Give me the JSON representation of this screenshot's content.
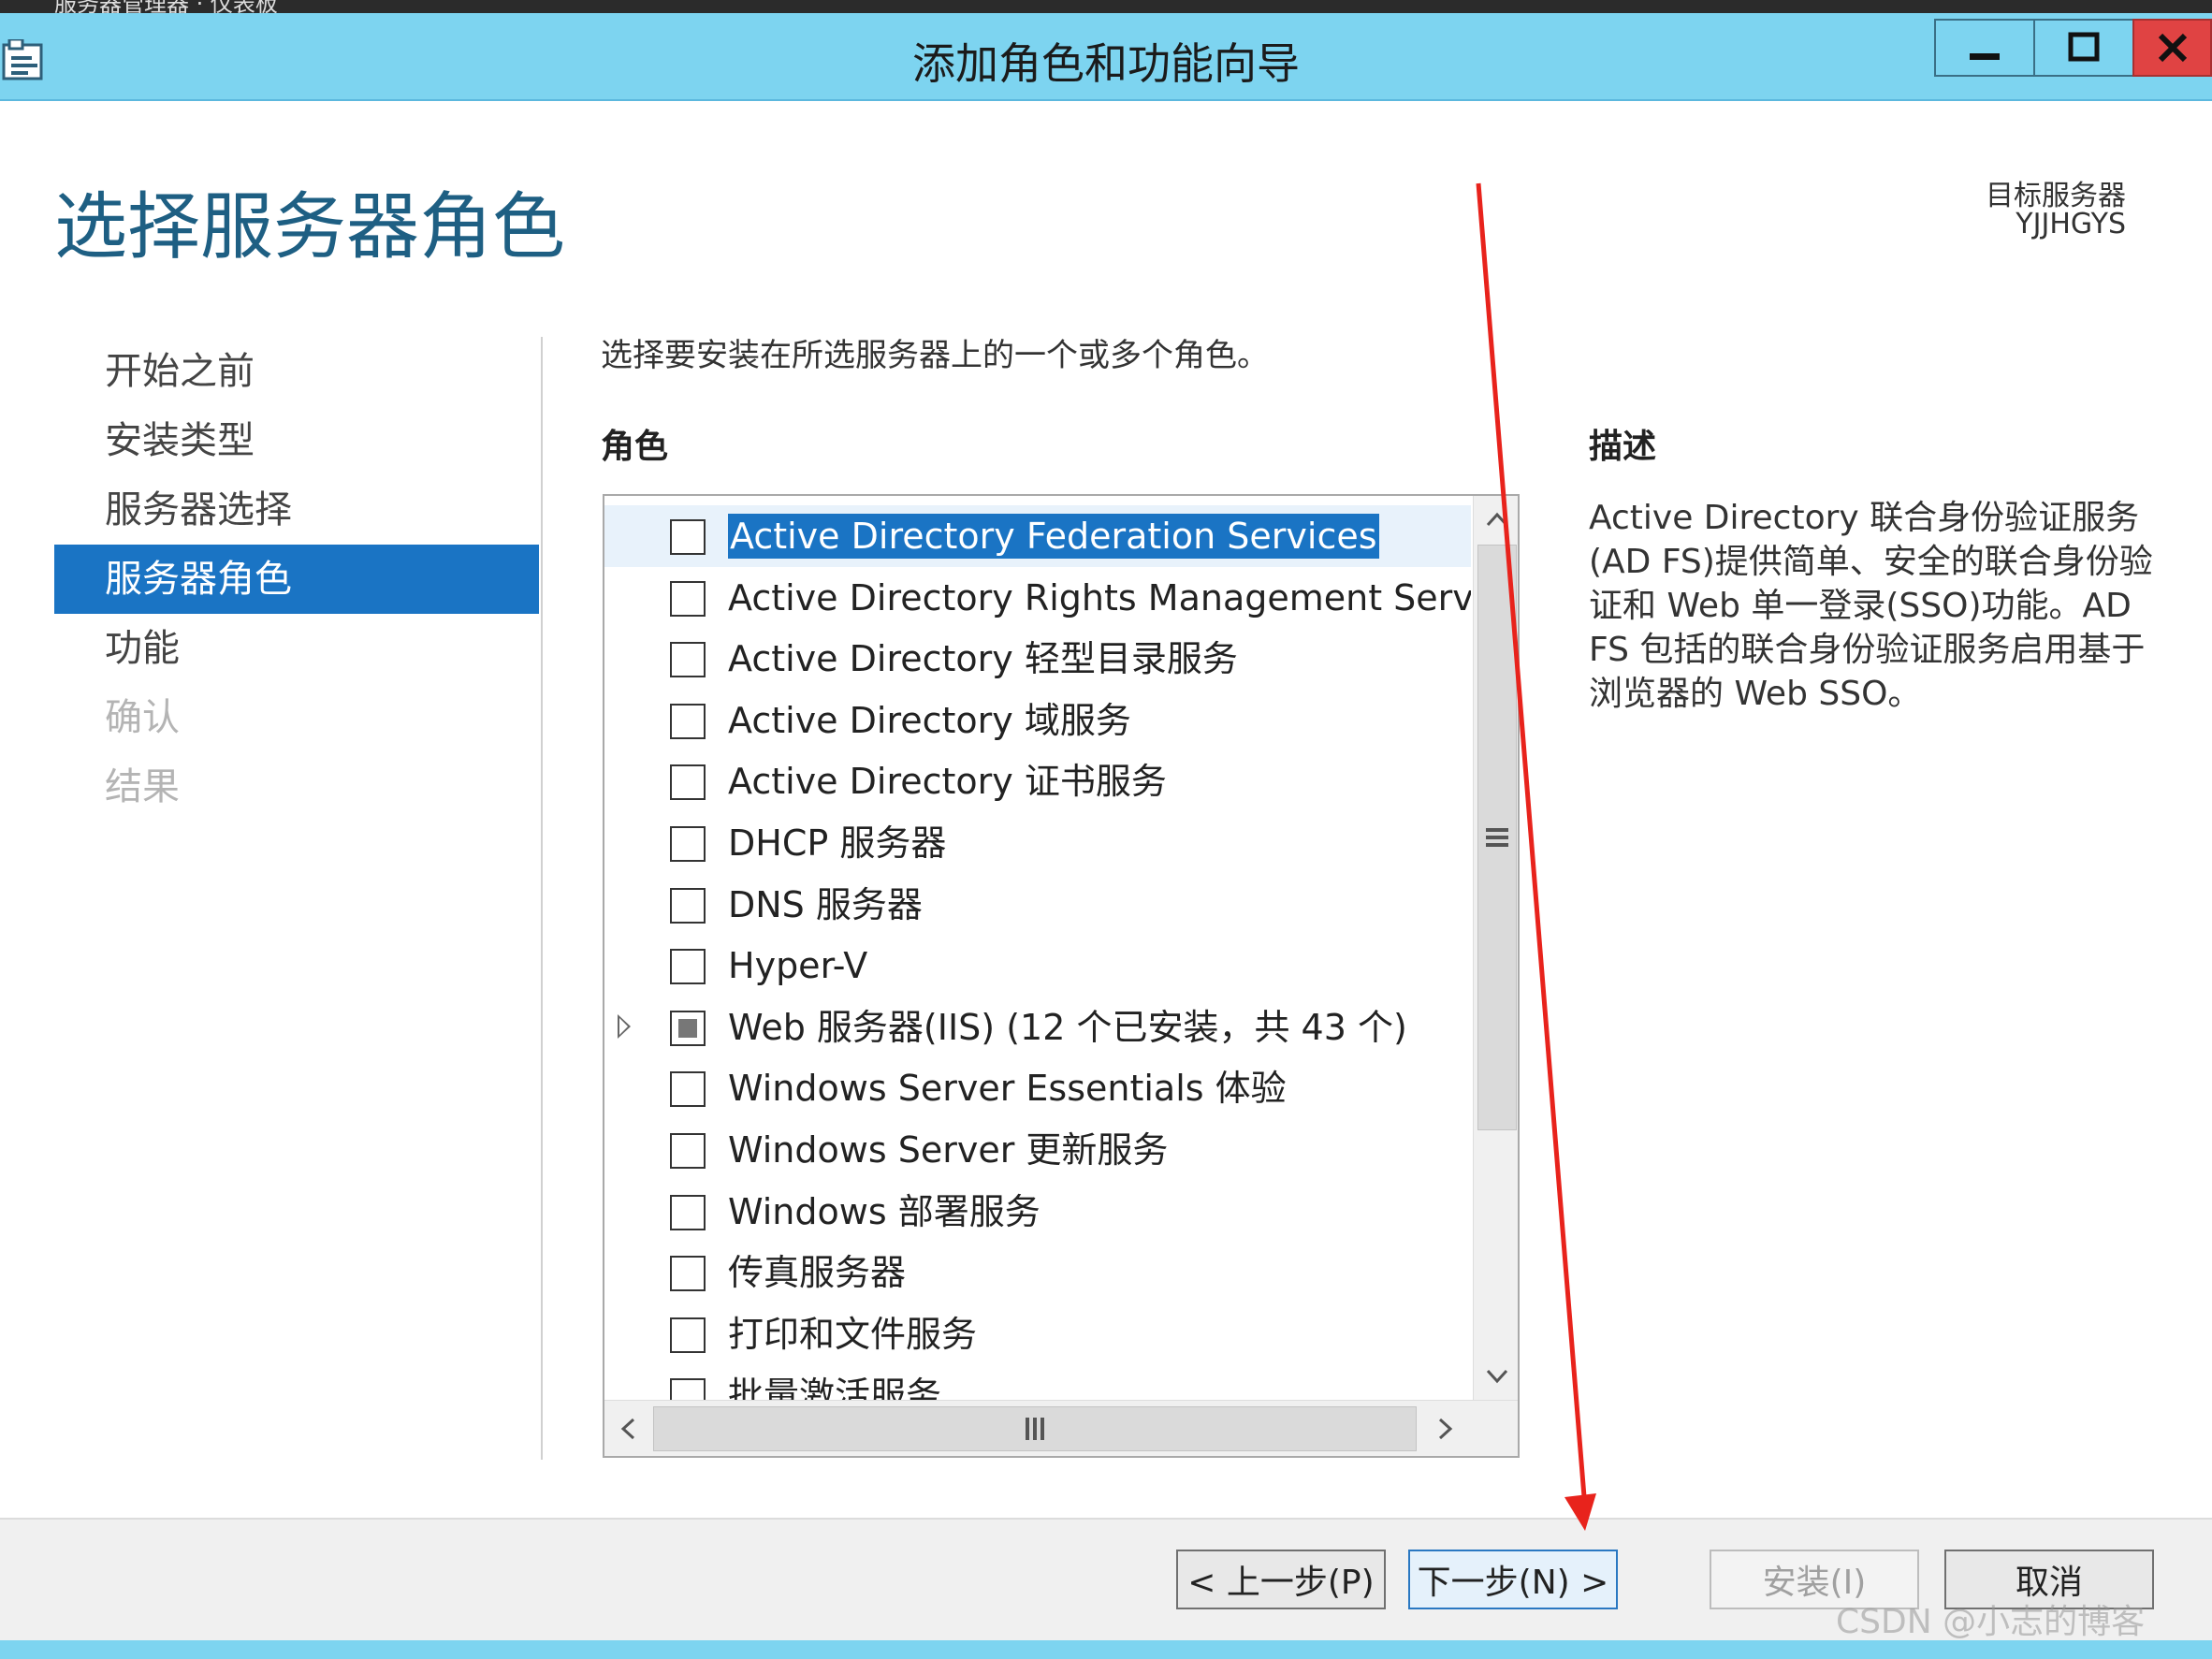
{
  "window": {
    "title": "添加角色和功能向导",
    "top_strip_text": "服务器管理器 · 仪表板"
  },
  "page": {
    "title": "选择服务器角色",
    "target_label": "目标服务器",
    "target_value": "YJJHGYS"
  },
  "nav": {
    "items": [
      {
        "label": "开始之前",
        "state": "normal"
      },
      {
        "label": "安装类型",
        "state": "normal"
      },
      {
        "label": "服务器选择",
        "state": "normal"
      },
      {
        "label": "服务器角色",
        "state": "active"
      },
      {
        "label": "功能",
        "state": "normal"
      },
      {
        "label": "确认",
        "state": "disabled"
      },
      {
        "label": "结果",
        "state": "disabled"
      }
    ]
  },
  "main": {
    "instruction": "选择要安装在所选服务器上的一个或多个角色。",
    "roles_heading": "角色",
    "roles": [
      {
        "label": "Active Directory Federation Services",
        "checked": "none",
        "selected": true,
        "expandable": false
      },
      {
        "label": "Active Directory Rights Management Services",
        "checked": "none",
        "selected": false,
        "expandable": false
      },
      {
        "label": "Active Directory 轻型目录服务",
        "checked": "none",
        "selected": false,
        "expandable": false
      },
      {
        "label": "Active Directory 域服务",
        "checked": "none",
        "selected": false,
        "expandable": false
      },
      {
        "label": "Active Directory 证书服务",
        "checked": "none",
        "selected": false,
        "expandable": false
      },
      {
        "label": "DHCP 服务器",
        "checked": "none",
        "selected": false,
        "expandable": false
      },
      {
        "label": "DNS 服务器",
        "checked": "none",
        "selected": false,
        "expandable": false
      },
      {
        "label": "Hyper-V",
        "checked": "none",
        "selected": false,
        "expandable": false
      },
      {
        "label": "Web 服务器(IIS) (12 个已安装，共 43 个)",
        "checked": "partial",
        "selected": false,
        "expandable": true
      },
      {
        "label": "Windows Server Essentials 体验",
        "checked": "none",
        "selected": false,
        "expandable": false
      },
      {
        "label": "Windows Server 更新服务",
        "checked": "none",
        "selected": false,
        "expandable": false
      },
      {
        "label": "Windows 部署服务",
        "checked": "none",
        "selected": false,
        "expandable": false
      },
      {
        "label": "传真服务器",
        "checked": "none",
        "selected": false,
        "expandable": false
      },
      {
        "label": "打印和文件服务",
        "checked": "none",
        "selected": false,
        "expandable": false
      },
      {
        "label": "批量激活服务",
        "checked": "none",
        "selected": false,
        "expandable": false
      }
    ],
    "description_heading": "描述",
    "description": "Active Directory 联合身份验证服务(AD FS)提供简单、安全的联合身份验证和 Web 单一登录(SSO)功能。AD FS 包括的联合身份验证服务启用基于浏览器的 Web SSO。"
  },
  "footer": {
    "prev_label": "< 上一步(P)",
    "next_label": "下一步(N) >",
    "install_label": "安装(I)",
    "cancel_label": "取消"
  },
  "watermark": "CSDN @小志的博客",
  "colors": {
    "titlebar": "#7dd4f0",
    "accent": "#1a74c4",
    "title_blue": "#1e5f83",
    "close": "#e04343",
    "annotation_arrow": "#e8231c"
  },
  "icons": [
    "app-icon",
    "minimize-icon",
    "maximize-icon",
    "close-icon",
    "chevron-up-icon",
    "chevron-down-icon",
    "chevron-left-icon",
    "chevron-right-icon",
    "grip-icon",
    "expand-triangle-icon"
  ]
}
